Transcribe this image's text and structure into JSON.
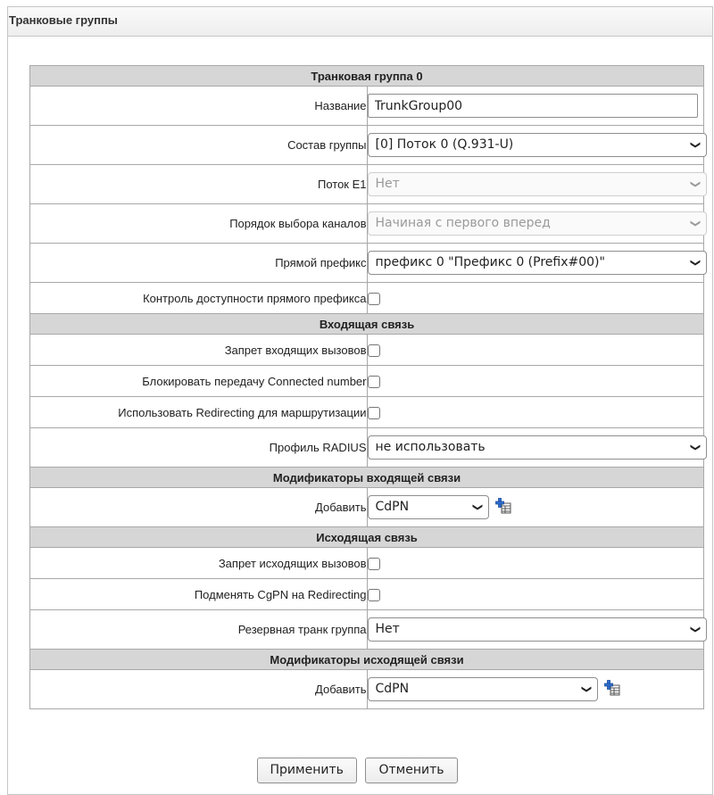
{
  "panel": {
    "title": "Транковые группы"
  },
  "form": {
    "sections": {
      "main": "Транковая группа 0",
      "incoming": "Входящая связь",
      "incoming_modifiers": "Модификаторы входящей связи",
      "outgoing": "Исходящая связь",
      "outgoing_modifiers": "Модификаторы исходящей связи"
    },
    "name": {
      "label": "Название",
      "value": "TrunkGroup00"
    },
    "group_members": {
      "label": "Состав группы",
      "selected": "[0] Поток 0 (Q.931-U)"
    },
    "stream_e1": {
      "label": "Поток E1",
      "selected": "Нет",
      "disabled": true
    },
    "channel_order": {
      "label": "Порядок выбора каналов",
      "selected": "Начиная с первого вперед",
      "disabled": true
    },
    "direct_prefix": {
      "label": "Прямой префикс",
      "selected": "префикс 0 \"Префикс 0 (Prefix#00)\""
    },
    "direct_prefix_check": {
      "label": "Контроль доступности прямого префикса",
      "checked": false
    },
    "deny_incoming": {
      "label": "Запрет входящих вызовов",
      "checked": false
    },
    "block_connected": {
      "label": "Блокировать передачу Connected number",
      "checked": false
    },
    "use_redirecting": {
      "label": "Использовать Redirecting для маршрутизации",
      "checked": false
    },
    "radius_profile": {
      "label": "Профиль RADIUS",
      "selected": "не использовать"
    },
    "incoming_add": {
      "label": "Добавить",
      "selected": "CdPN"
    },
    "deny_outgoing": {
      "label": "Запрет исходящих вызовов",
      "checked": false
    },
    "replace_cgpn": {
      "label": "Подменять CgPN на Redirecting",
      "checked": false
    },
    "reserve_trunk": {
      "label": "Резервная транк группа",
      "selected": "Нет"
    },
    "outgoing_add": {
      "label": "Добавить",
      "selected": "CdPN"
    }
  },
  "buttons": {
    "apply": "Применить",
    "cancel": "Отменить"
  },
  "icons": {
    "dropdown": "chevron-down-icon",
    "add": "add-modifier-icon"
  },
  "colors": {
    "section_bg": "#d6d6d6",
    "border": "#a8a8a8",
    "icon_blue": "#2f6fd0"
  }
}
